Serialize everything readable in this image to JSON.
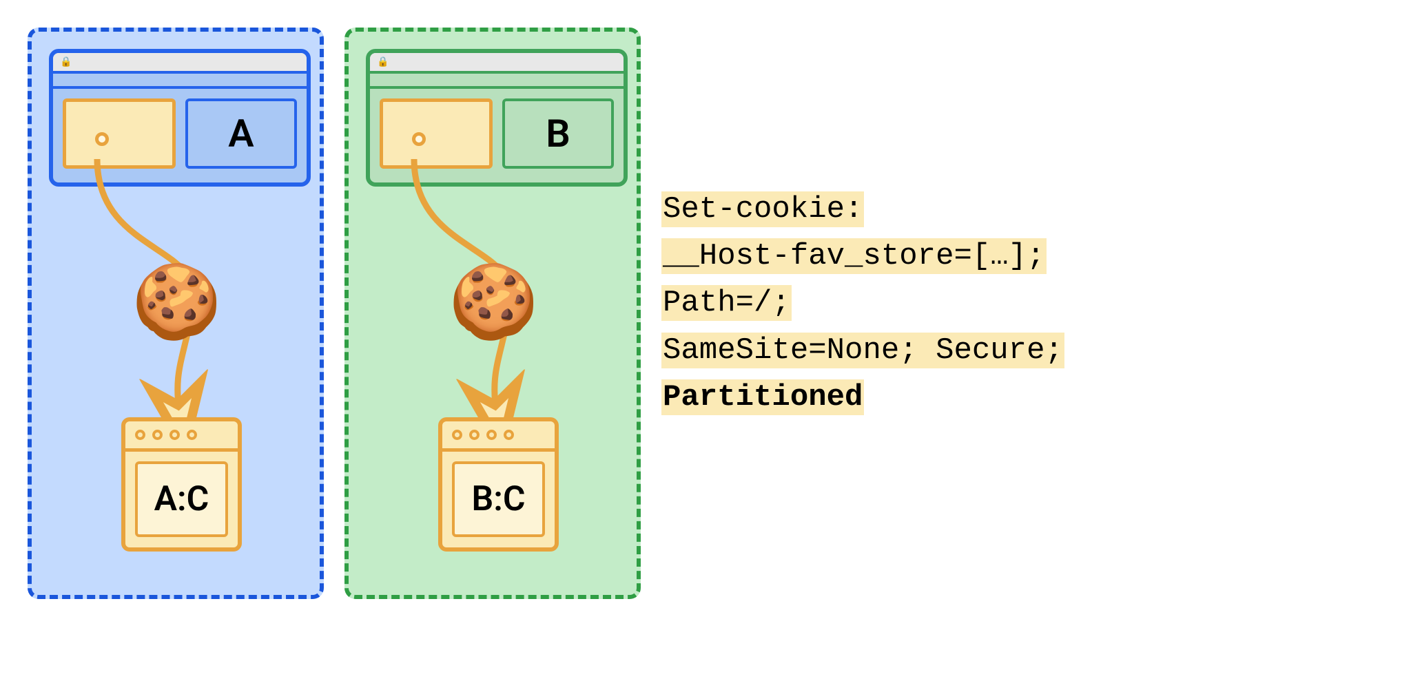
{
  "partitions": {
    "a": {
      "site_label": "A",
      "jar_label": "A:C"
    },
    "b": {
      "site_label": "B",
      "jar_label": "B:C"
    }
  },
  "code": {
    "l1": "Set-cookie:",
    "l2": "__Host-fav_store=[…];",
    "l3": "Path=/;",
    "l4": "SameSite=None; Secure;",
    "l5": "Partitioned"
  },
  "colors": {
    "blue": "#1a56db",
    "green": "#2f9e44",
    "amber": "#e8a33d",
    "highlight": "#fbeab6"
  }
}
